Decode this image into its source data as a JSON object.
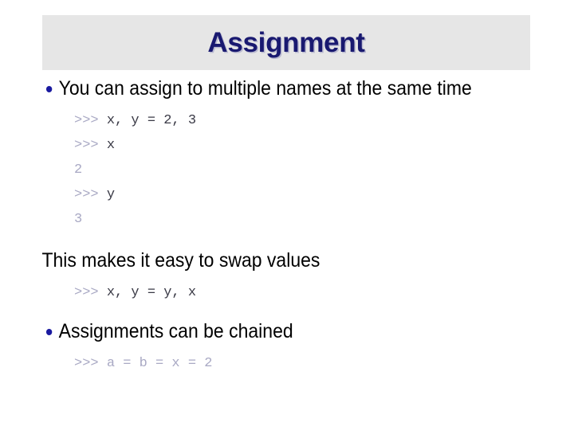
{
  "slide": {
    "title": "Assignment",
    "title_color": "#191970",
    "band_color": "#e6e6e6",
    "bullet_color": "#1a1aa0",
    "body_color": "#000000",
    "prompt_color": "#a9a9c4",
    "code_color": "#3a3a46"
  },
  "blocks": {
    "bullet1": {
      "text": "You can assign to multiple names at the same time",
      "code": [
        {
          "prompt": ">>> ",
          "source": "x, y = 2, 3",
          "kind": "input"
        },
        {
          "prompt": ">>> ",
          "source": "x",
          "kind": "input"
        },
        {
          "prompt": "",
          "source": "2",
          "kind": "output"
        },
        {
          "prompt": ">>> ",
          "source": "y",
          "kind": "input"
        },
        {
          "prompt": "",
          "source": "3",
          "kind": "output"
        }
      ]
    },
    "line2": {
      "text": "This makes it easy to swap values",
      "code": [
        {
          "prompt": ">>> ",
          "source": "x, y = y, x",
          "kind": "input"
        }
      ]
    },
    "bullet3": {
      "text": "Assignments can be chained",
      "code": [
        {
          "prompt": ">>> ",
          "source": "a = b = x = 2",
          "kind": "faint"
        }
      ]
    }
  }
}
